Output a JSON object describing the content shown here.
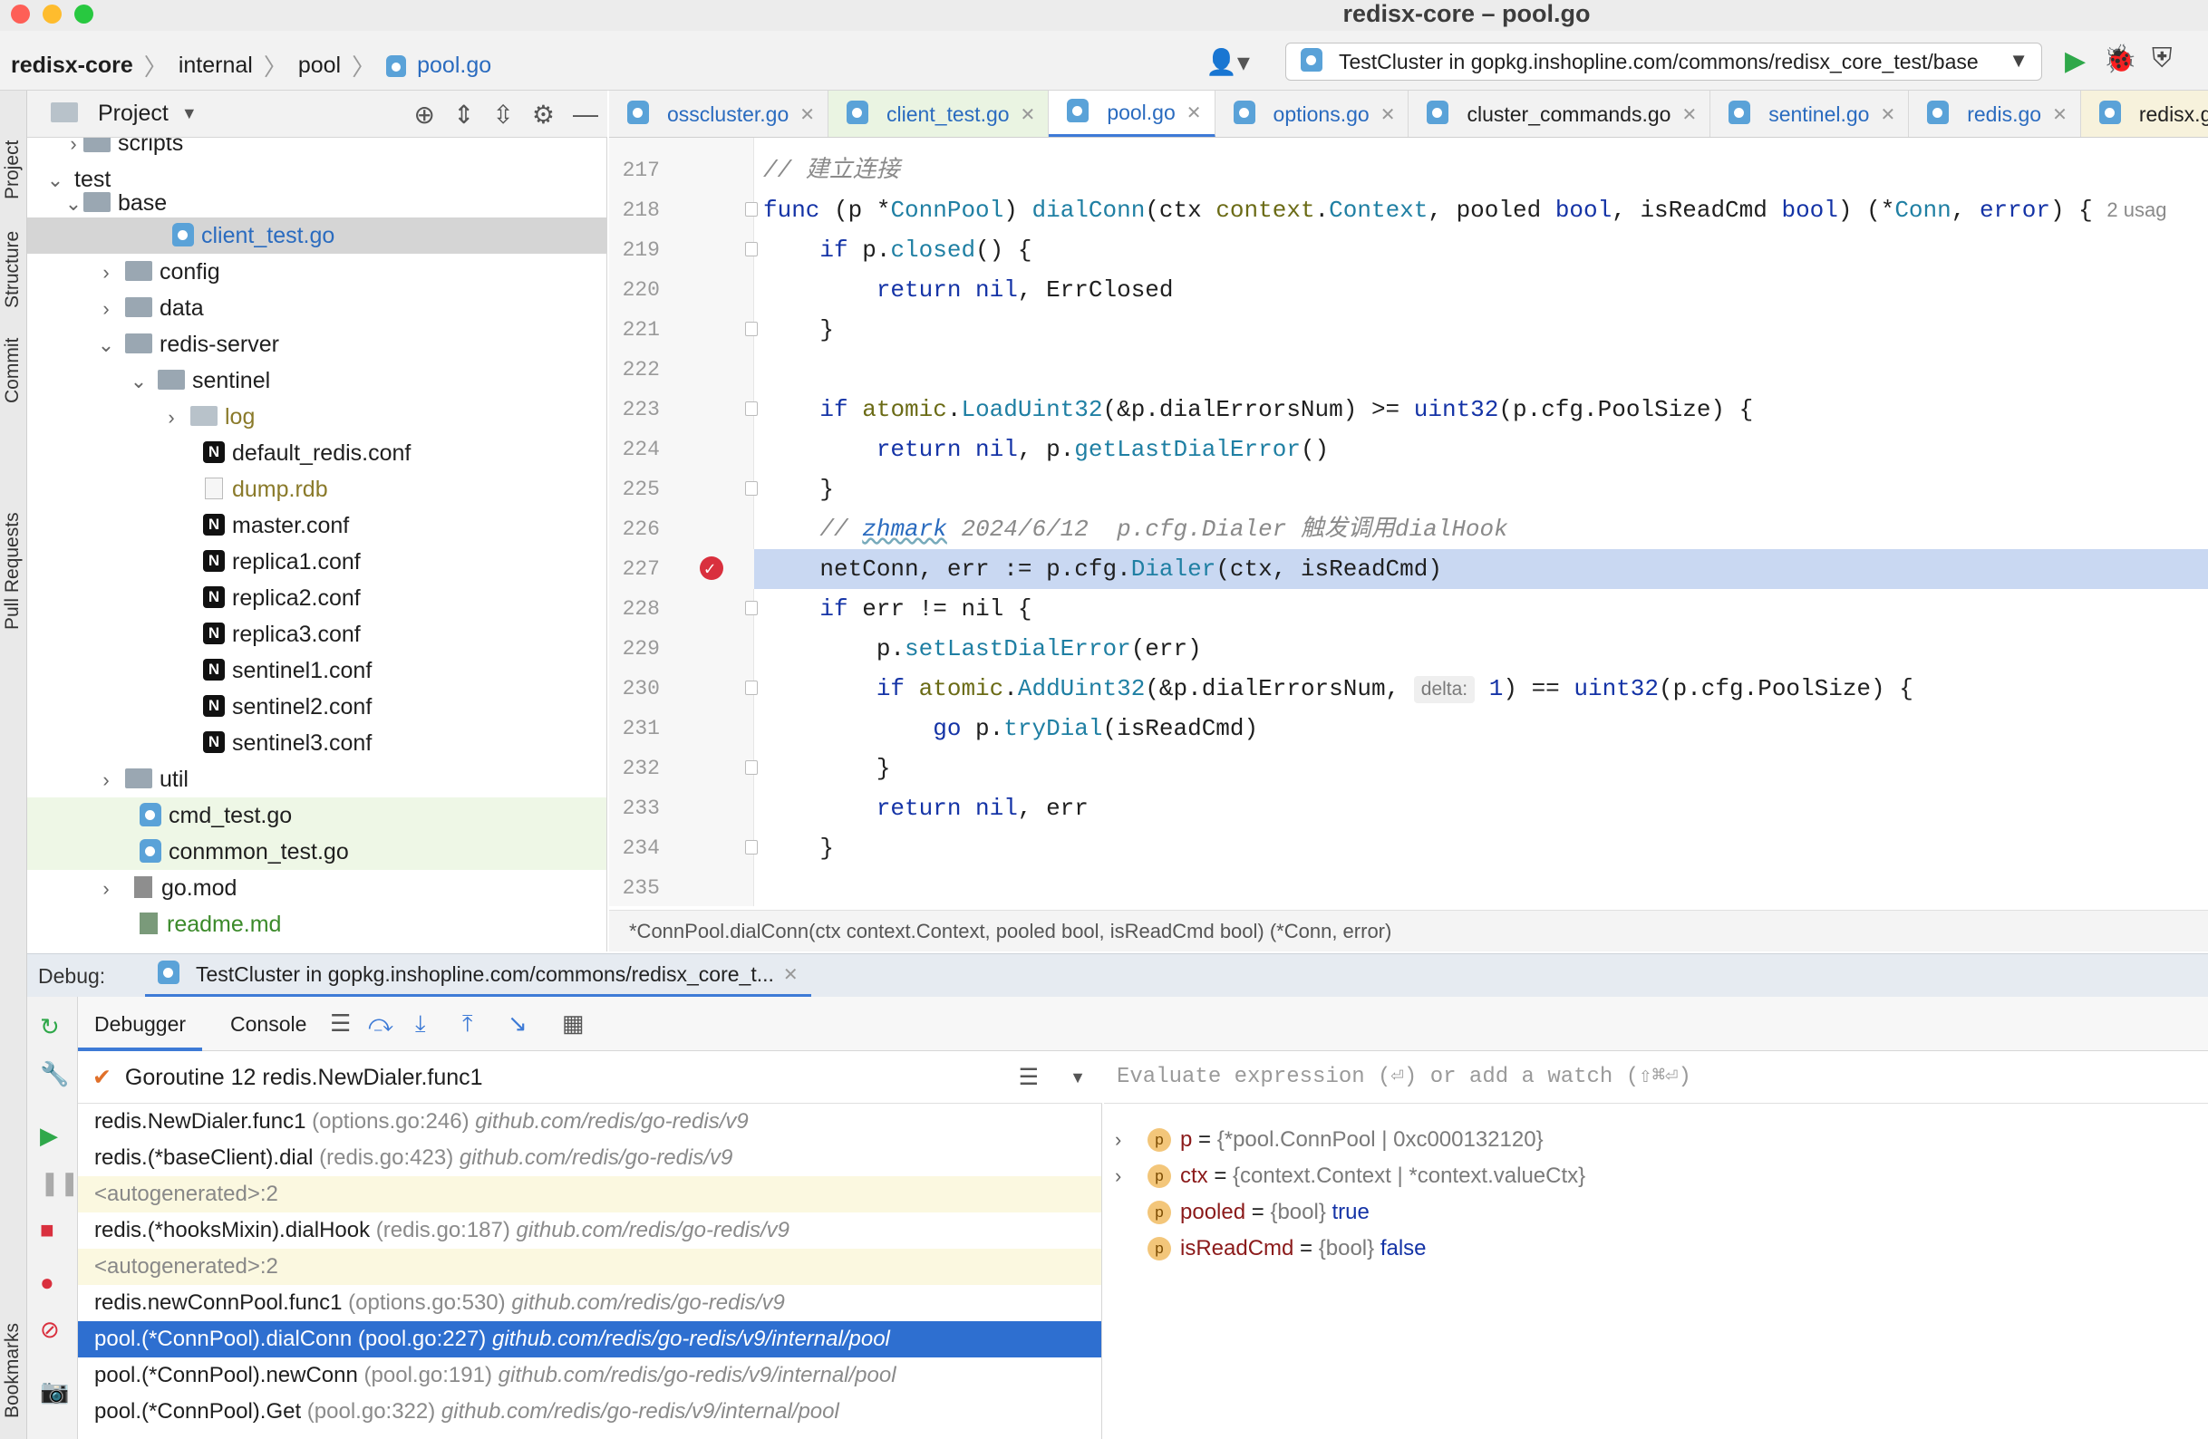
{
  "window": {
    "title": "redisx-core – pool.go"
  },
  "breadcrumb": {
    "items": [
      "redisx-core",
      "internal",
      "pool",
      "pool.go"
    ]
  },
  "run_config": {
    "label": "TestCluster in gopkg.inshopline.com/commons/redisx_core_test/base"
  },
  "side_tabs": [
    "Project",
    "Structure",
    "Commit",
    "Pull Requests",
    "Bookmarks"
  ],
  "project": {
    "title": "Project",
    "tree": [
      {
        "label": "scripts",
        "icon": "folder"
      },
      {
        "label": "test",
        "icon": "folder"
      },
      {
        "label": "base",
        "icon": "folder"
      },
      {
        "label": "client_test.go",
        "icon": "go-test-file"
      },
      {
        "label": "config",
        "icon": "folder"
      },
      {
        "label": "data",
        "icon": "folder"
      },
      {
        "label": "redis-server",
        "icon": "folder"
      },
      {
        "label": "sentinel",
        "icon": "folder"
      },
      {
        "label": "log",
        "icon": "folder"
      },
      {
        "label": "default_redis.conf",
        "icon": "conf-file"
      },
      {
        "label": "dump.rdb",
        "icon": "blank-file"
      },
      {
        "label": "master.conf",
        "icon": "conf-file"
      },
      {
        "label": "replica1.conf",
        "icon": "conf-file"
      },
      {
        "label": "replica2.conf",
        "icon": "conf-file"
      },
      {
        "label": "replica3.conf",
        "icon": "conf-file"
      },
      {
        "label": "sentinel1.conf",
        "icon": "conf-file"
      },
      {
        "label": "sentinel2.conf",
        "icon": "conf-file"
      },
      {
        "label": "sentinel3.conf",
        "icon": "conf-file"
      },
      {
        "label": "util",
        "icon": "folder"
      },
      {
        "label": "cmd_test.go",
        "icon": "go-test-file"
      },
      {
        "label": "conmmon_test.go",
        "icon": "go-test-file"
      },
      {
        "label": "go.mod",
        "icon": "mod-file"
      },
      {
        "label": "readme.md",
        "icon": "md-file"
      }
    ]
  },
  "tabs": [
    "osscluster.go",
    "client_test.go",
    "pool.go",
    "options.go",
    "cluster_commands.go",
    "sentinel.go",
    "redis.go",
    "redisx.g"
  ],
  "editor": {
    "line_numbers": [
      "217",
      "218",
      "219",
      "220",
      "221",
      "222",
      "223",
      "224",
      "225",
      "226",
      "227",
      "228",
      "229",
      "230",
      "231",
      "232",
      "233",
      "234",
      "235"
    ],
    "l217_comment": "// 建立连接",
    "l218": {
      "kw_func": "func",
      "open": " (p *",
      "recv_type": "ConnPool",
      "close": ") ",
      "fn": "dialConn",
      "args1": "(ctx ",
      "pkg": "context",
      "dot": ".",
      "ctxtype": "Context",
      "args2": ", pooled ",
      "bool1": "bool",
      "args3": ", isReadCmd ",
      "bool2": "bool",
      "args4": ") (*",
      "conn": "Conn",
      "comma": ", ",
      "err": "error",
      "brace": ") {",
      "usages": "2 usag"
    },
    "l219": {
      "kw": "if",
      "p": " p.",
      "fn": "closed",
      "rest": "() {"
    },
    "l220": {
      "kw": "return",
      "nil": " nil",
      "rest": ", ErrClosed"
    },
    "l221": "}",
    "l223": {
      "kw": "if",
      "pkg": " atomic",
      "dot": ".",
      "fn": "LoadUint32",
      "a": "(&p.dialErrorsNum) >= ",
      "ty": "uint32",
      "b": "(p.cfg.PoolSize) {"
    },
    "l224": {
      "kw": "return",
      "nil": " nil",
      "a": ", p.",
      "fn": "getLastDialError",
      "b": "()"
    },
    "l225": "}",
    "l226": {
      "prefix": "// ",
      "author": "zhmark",
      "rest": " 2024/6/12  p.cfg.Dialer 触发调用dialHook"
    },
    "l227": {
      "a": "netConn, err := p.cfg.",
      "fn": "Dialer",
      "b": "(ctx, isReadCmd)"
    },
    "l228": {
      "kw": "if",
      "rest": " err != nil {"
    },
    "l229": {
      "a": "p.",
      "fn": "setLastDialError",
      "b": "(err)"
    },
    "l230": {
      "kw": "if",
      "pkg": " atomic",
      "dot": ".",
      "fn": "AddUint32",
      "a": "(&p.dialErrorsNum, ",
      "hint": "delta:",
      "num": " 1",
      "b": ") == ",
      "ty": "uint32",
      "c": "(p.cfg.PoolSize) {"
    },
    "l231": {
      "kw": "go",
      "a": " p.",
      "fn": "tryDial",
      "b": "(isReadCmd)"
    },
    "l232": "}",
    "l233": {
      "kw": "return",
      "nil": " nil",
      "rest": ", err"
    },
    "l234": "}"
  },
  "status_line": "*ConnPool.dialConn(ctx context.Context, pooled bool, isReadCmd bool) (*Conn, error)",
  "debug": {
    "label": "Debug:",
    "session": "TestCluster in gopkg.inshopline.com/commons/redisx_core_t...",
    "subtabs": [
      "Debugger",
      "Console"
    ],
    "goroutine": "Goroutine 12 redis.NewDialer.func1",
    "frames": [
      {
        "fn": "redis.NewDialer.func1",
        "loc": " (options.go:246) ",
        "pkg": "github.com/redis/go-redis/v9"
      },
      {
        "fn": "redis.(*baseClient).dial",
        "loc": " (redis.go:423) ",
        "pkg": "github.com/redis/go-redis/v9"
      },
      {
        "fn": "<autogenerated>:2",
        "loc": "",
        "pkg": ""
      },
      {
        "fn": "redis.(*hooksMixin).dialHook",
        "loc": " (redis.go:187) ",
        "pkg": "github.com/redis/go-redis/v9"
      },
      {
        "fn": "<autogenerated>:2",
        "loc": "",
        "pkg": ""
      },
      {
        "fn": "redis.newConnPool.func1",
        "loc": " (options.go:530) ",
        "pkg": "github.com/redis/go-redis/v9"
      },
      {
        "fn": "pool.(*ConnPool).dialConn",
        "loc": " (pool.go:227) ",
        "pkg": "github.com/redis/go-redis/v9/internal/pool"
      },
      {
        "fn": "pool.(*ConnPool).newConn",
        "loc": " (pool.go:191) ",
        "pkg": "github.com/redis/go-redis/v9/internal/pool"
      },
      {
        "fn": "pool.(*ConnPool).Get",
        "loc": " (pool.go:322) ",
        "pkg": "github.com/redis/go-redis/v9/internal/pool"
      }
    ],
    "eval_placeholder": "Evaluate expression (⏎) or add a watch (⇧⌘⏎)",
    "variables": [
      {
        "icon": "p",
        "name": "p",
        "eq": " = ",
        "type": "{*pool.ConnPool | 0xc000132120}",
        "value": ""
      },
      {
        "icon": "p",
        "name": "ctx",
        "eq": " = ",
        "type": "{context.Context | *context.valueCtx}",
        "value": ""
      },
      {
        "icon": "p",
        "name": "pooled",
        "eq": " = ",
        "type": "{bool} ",
        "value": "true"
      },
      {
        "icon": "p",
        "name": "isReadCmd",
        "eq": " = ",
        "type": "{bool} ",
        "value": "false"
      }
    ]
  },
  "colors": {
    "accent": "#3d7ad6",
    "selection": "#2e6fd0",
    "highlight_line": "#c9d8f2",
    "breakpoint": "#d9303e"
  }
}
